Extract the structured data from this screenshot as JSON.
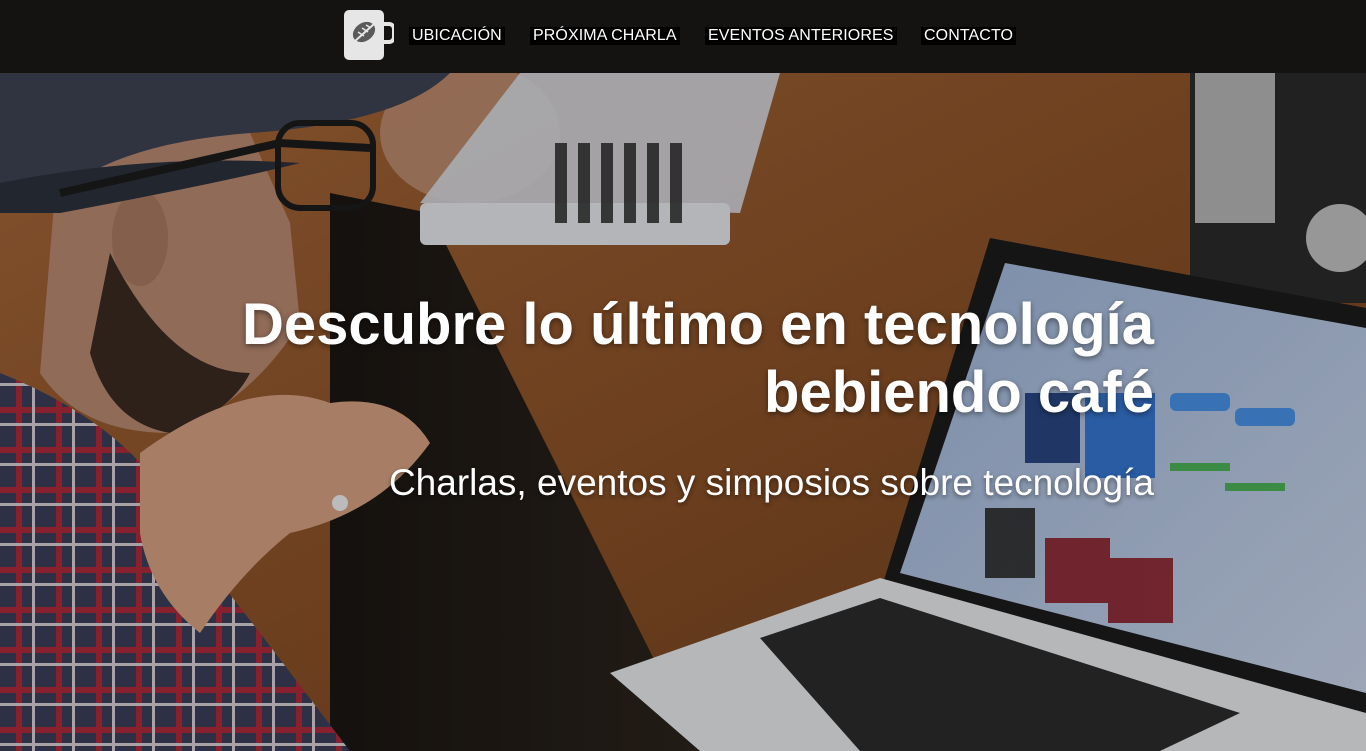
{
  "nav": {
    "logo_icon": "coffee-cup-leaf-icon",
    "items": [
      {
        "label": "UBICACIÓN"
      },
      {
        "label": "PRÓXIMA CHARLA"
      },
      {
        "label": "EVENTOS ANTERIORES"
      },
      {
        "label": "CONTACTO"
      }
    ]
  },
  "hero": {
    "title_line1": "Descubre lo último en tecnología",
    "title_line2": "bebiendo café",
    "subtitle": "Charlas, eventos y simposios sobre tecnología",
    "background_description_icon": "people-laptops-photo"
  },
  "colors": {
    "nav_bg": "#141312",
    "nav_text": "#ffffff",
    "logo_bg": "#e6e6e6",
    "hero_text": "#ffffff"
  }
}
